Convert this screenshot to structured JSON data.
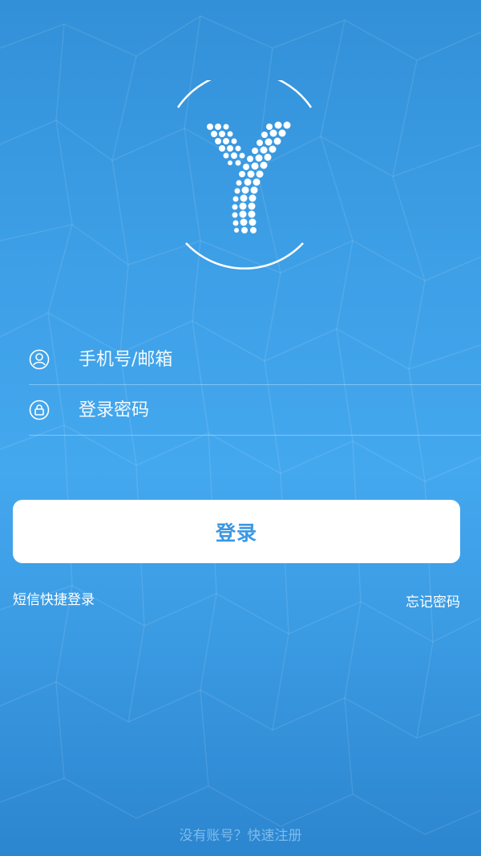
{
  "app": {
    "logo_icon": "y-dotted-logo-icon"
  },
  "form": {
    "account_placeholder": "手机号/邮箱",
    "account_icon": "user-circle-icon",
    "password_placeholder": "登录密码",
    "password_icon": "lock-circle-icon",
    "login_label": "登录"
  },
  "links": {
    "sms_login": "短信快捷登录",
    "forgot_password": "忘记密码"
  },
  "footer": {
    "register": "没有账号？快速注册"
  },
  "colors": {
    "background_primary": "#3d9fe6",
    "button_bg": "#ffffff",
    "button_text": "#3b97e3",
    "text": "#ffffff"
  }
}
